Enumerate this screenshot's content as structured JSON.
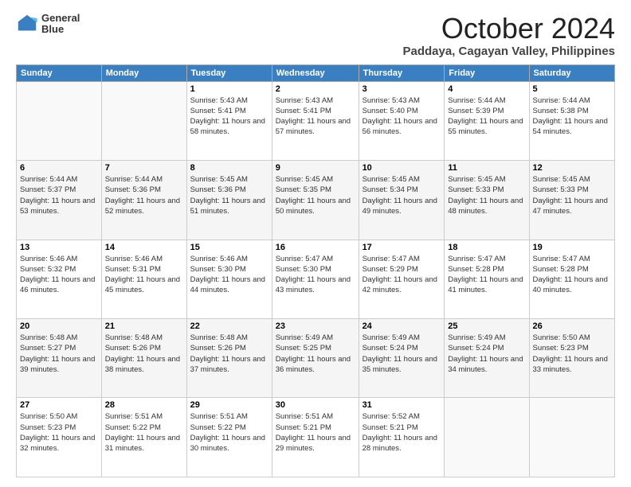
{
  "logo": {
    "line1": "General",
    "line2": "Blue"
  },
  "title": "October 2024",
  "location": "Paddaya, Cagayan Valley, Philippines",
  "days_header": [
    "Sunday",
    "Monday",
    "Tuesday",
    "Wednesday",
    "Thursday",
    "Friday",
    "Saturday"
  ],
  "weeks": [
    [
      {
        "day": "",
        "info": ""
      },
      {
        "day": "",
        "info": ""
      },
      {
        "day": "1",
        "info": "Sunrise: 5:43 AM\nSunset: 5:41 PM\nDaylight: 11 hours and 58 minutes."
      },
      {
        "day": "2",
        "info": "Sunrise: 5:43 AM\nSunset: 5:41 PM\nDaylight: 11 hours and 57 minutes."
      },
      {
        "day": "3",
        "info": "Sunrise: 5:43 AM\nSunset: 5:40 PM\nDaylight: 11 hours and 56 minutes."
      },
      {
        "day": "4",
        "info": "Sunrise: 5:44 AM\nSunset: 5:39 PM\nDaylight: 11 hours and 55 minutes."
      },
      {
        "day": "5",
        "info": "Sunrise: 5:44 AM\nSunset: 5:38 PM\nDaylight: 11 hours and 54 minutes."
      }
    ],
    [
      {
        "day": "6",
        "info": "Sunrise: 5:44 AM\nSunset: 5:37 PM\nDaylight: 11 hours and 53 minutes."
      },
      {
        "day": "7",
        "info": "Sunrise: 5:44 AM\nSunset: 5:36 PM\nDaylight: 11 hours and 52 minutes."
      },
      {
        "day": "8",
        "info": "Sunrise: 5:45 AM\nSunset: 5:36 PM\nDaylight: 11 hours and 51 minutes."
      },
      {
        "day": "9",
        "info": "Sunrise: 5:45 AM\nSunset: 5:35 PM\nDaylight: 11 hours and 50 minutes."
      },
      {
        "day": "10",
        "info": "Sunrise: 5:45 AM\nSunset: 5:34 PM\nDaylight: 11 hours and 49 minutes."
      },
      {
        "day": "11",
        "info": "Sunrise: 5:45 AM\nSunset: 5:33 PM\nDaylight: 11 hours and 48 minutes."
      },
      {
        "day": "12",
        "info": "Sunrise: 5:45 AM\nSunset: 5:33 PM\nDaylight: 11 hours and 47 minutes."
      }
    ],
    [
      {
        "day": "13",
        "info": "Sunrise: 5:46 AM\nSunset: 5:32 PM\nDaylight: 11 hours and 46 minutes."
      },
      {
        "day": "14",
        "info": "Sunrise: 5:46 AM\nSunset: 5:31 PM\nDaylight: 11 hours and 45 minutes."
      },
      {
        "day": "15",
        "info": "Sunrise: 5:46 AM\nSunset: 5:30 PM\nDaylight: 11 hours and 44 minutes."
      },
      {
        "day": "16",
        "info": "Sunrise: 5:47 AM\nSunset: 5:30 PM\nDaylight: 11 hours and 43 minutes."
      },
      {
        "day": "17",
        "info": "Sunrise: 5:47 AM\nSunset: 5:29 PM\nDaylight: 11 hours and 42 minutes."
      },
      {
        "day": "18",
        "info": "Sunrise: 5:47 AM\nSunset: 5:28 PM\nDaylight: 11 hours and 41 minutes."
      },
      {
        "day": "19",
        "info": "Sunrise: 5:47 AM\nSunset: 5:28 PM\nDaylight: 11 hours and 40 minutes."
      }
    ],
    [
      {
        "day": "20",
        "info": "Sunrise: 5:48 AM\nSunset: 5:27 PM\nDaylight: 11 hours and 39 minutes."
      },
      {
        "day": "21",
        "info": "Sunrise: 5:48 AM\nSunset: 5:26 PM\nDaylight: 11 hours and 38 minutes."
      },
      {
        "day": "22",
        "info": "Sunrise: 5:48 AM\nSunset: 5:26 PM\nDaylight: 11 hours and 37 minutes."
      },
      {
        "day": "23",
        "info": "Sunrise: 5:49 AM\nSunset: 5:25 PM\nDaylight: 11 hours and 36 minutes."
      },
      {
        "day": "24",
        "info": "Sunrise: 5:49 AM\nSunset: 5:24 PM\nDaylight: 11 hours and 35 minutes."
      },
      {
        "day": "25",
        "info": "Sunrise: 5:49 AM\nSunset: 5:24 PM\nDaylight: 11 hours and 34 minutes."
      },
      {
        "day": "26",
        "info": "Sunrise: 5:50 AM\nSunset: 5:23 PM\nDaylight: 11 hours and 33 minutes."
      }
    ],
    [
      {
        "day": "27",
        "info": "Sunrise: 5:50 AM\nSunset: 5:23 PM\nDaylight: 11 hours and 32 minutes."
      },
      {
        "day": "28",
        "info": "Sunrise: 5:51 AM\nSunset: 5:22 PM\nDaylight: 11 hours and 31 minutes."
      },
      {
        "day": "29",
        "info": "Sunrise: 5:51 AM\nSunset: 5:22 PM\nDaylight: 11 hours and 30 minutes."
      },
      {
        "day": "30",
        "info": "Sunrise: 5:51 AM\nSunset: 5:21 PM\nDaylight: 11 hours and 29 minutes."
      },
      {
        "day": "31",
        "info": "Sunrise: 5:52 AM\nSunset: 5:21 PM\nDaylight: 11 hours and 28 minutes."
      },
      {
        "day": "",
        "info": ""
      },
      {
        "day": "",
        "info": ""
      }
    ]
  ]
}
